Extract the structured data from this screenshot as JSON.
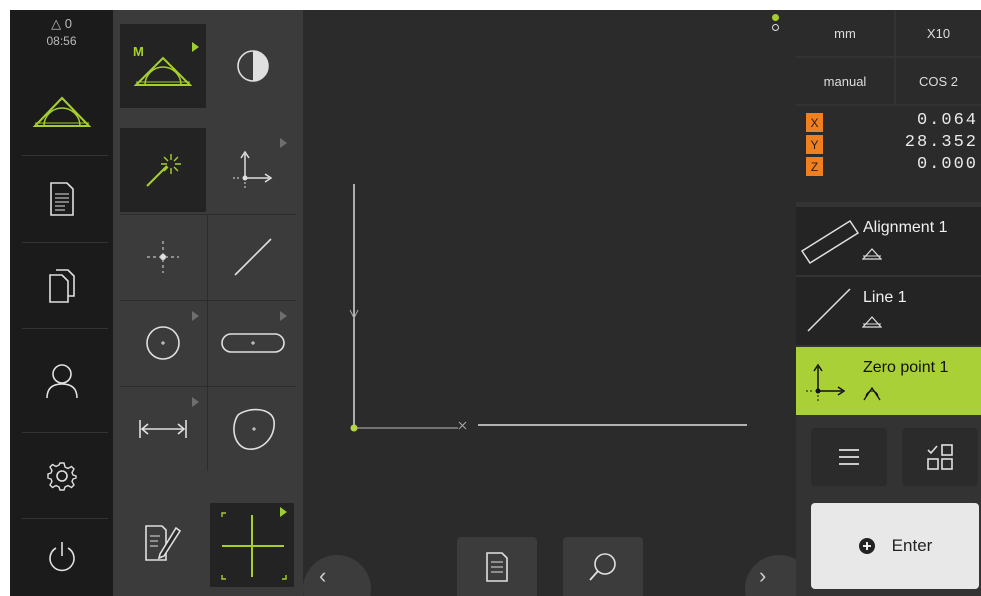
{
  "status": {
    "warnings": "0",
    "time": "08:56"
  },
  "nav": {
    "items": [
      {
        "name": "measure",
        "icon": "measure-triangle-icon"
      },
      {
        "name": "protocol",
        "icon": "document-list-icon"
      },
      {
        "name": "file-management",
        "icon": "files-icon"
      },
      {
        "name": "user-login",
        "icon": "user-icon"
      },
      {
        "name": "settings",
        "icon": "gear-icon"
      },
      {
        "name": "switch-off",
        "icon": "power-icon"
      }
    ]
  },
  "tools": {
    "mode_label": "M",
    "items": [
      "manual-measure-icon",
      "contrast-icon",
      "measure-magic-wand-icon",
      "zero-point-icon",
      "point-icon",
      "line-icon",
      "circle-icon",
      "slot-icon",
      "distance-icon",
      "blob-icon",
      "sketch-icon",
      "crosshair-icon"
    ]
  },
  "units": {
    "unit": "mm",
    "magnification": "X10",
    "mode": "manual",
    "coordinate_system": "COS 2"
  },
  "positions": [
    {
      "axis": "X",
      "value": "0.064"
    },
    {
      "axis": "Y",
      "value": "28.352"
    },
    {
      "axis": "Z",
      "value": "0.000"
    }
  ],
  "features": [
    {
      "name": "Alignment 1",
      "icon": "alignment-icon",
      "active": false
    },
    {
      "name": "Line 1",
      "icon": "line-icon",
      "active": false
    },
    {
      "name": "Zero point 1",
      "icon": "zero-point-icon",
      "active": true
    }
  ],
  "actions": {
    "menu_icon": "menu-icon",
    "select_icon": "select-features-icon",
    "enter_label": "Enter",
    "enter_icon": "plus-circle-icon"
  },
  "bottom": {
    "protocol_icon": "document-icon",
    "search_icon": "search-icon",
    "left_chevron": "‹",
    "right_chevron": "›"
  },
  "colors": {
    "accent": "#9fcf2d",
    "active_feature": "#aad038",
    "axis_badge": "#f07f20",
    "background": "#2b2b2b"
  }
}
